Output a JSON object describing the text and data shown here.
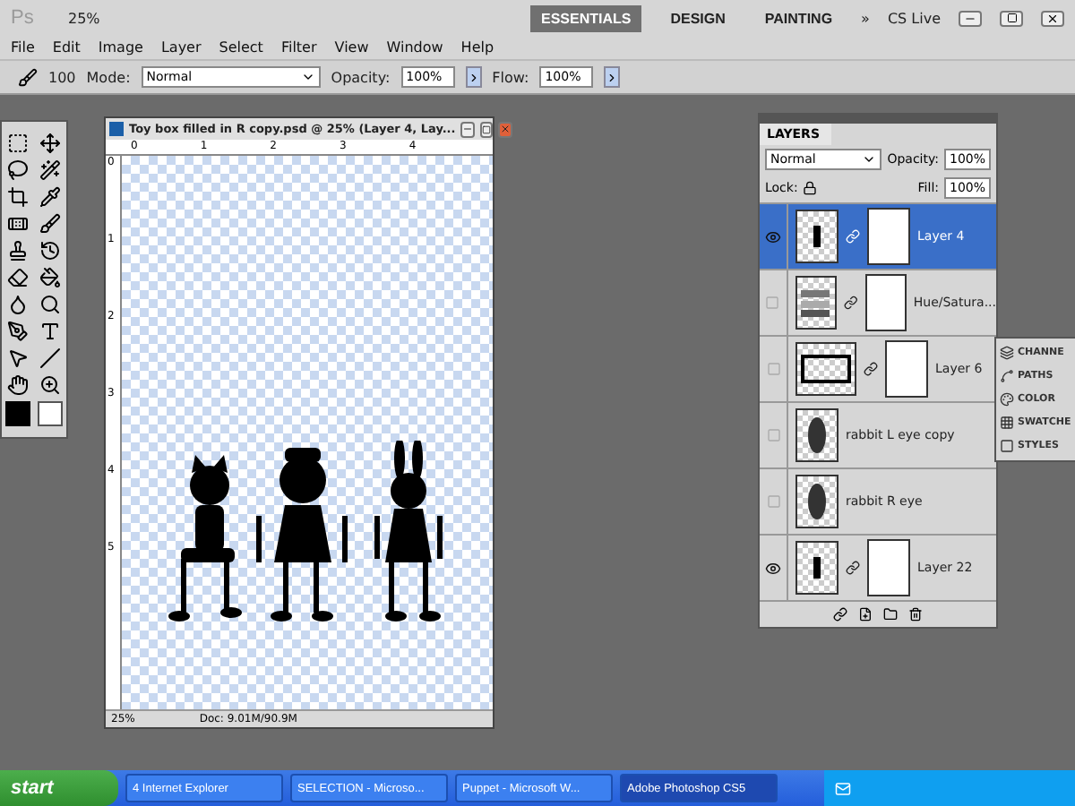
{
  "app_bar": {
    "logo": "Ps",
    "zoom": "25%",
    "workspaces": [
      {
        "label": "ESSENTIALS",
        "selected": true
      },
      {
        "label": "DESIGN",
        "selected": false
      },
      {
        "label": "PAINTING",
        "selected": false
      }
    ],
    "more": "»",
    "cs_live": "CS Live"
  },
  "menu": [
    "File",
    "Edit",
    "Image",
    "Layer",
    "Select",
    "Filter",
    "View",
    "Window",
    "Help"
  ],
  "options": {
    "brush_size": "100",
    "mode_label": "Mode:",
    "mode": "Normal",
    "opacity_label": "Opacity:",
    "opacity": "100%",
    "flow_label": "Flow:",
    "flow": "100%"
  },
  "document": {
    "title": "Toy box filled in R copy.psd @ 25% (Layer 4, Lay...",
    "ruler_h": [
      "0",
      "1",
      "2",
      "3",
      "4"
    ],
    "ruler_v": [
      "0",
      "1",
      "2",
      "3",
      "4",
      "5"
    ],
    "zoom": "25%",
    "doc_size": "Doc: 9.01M/90.9M"
  },
  "layers": {
    "tab": "LAYERS",
    "blend": "Normal",
    "opacity_label": "Opacity:",
    "opacity": "100%",
    "lock_label": "Lock:",
    "fill_label": "Fill:",
    "fill": "100%",
    "items": [
      {
        "name": "Layer 4",
        "visible": true,
        "selected": true,
        "kind": "masked"
      },
      {
        "name": "Hue/Satura...",
        "visible": false,
        "selected": false,
        "kind": "adjustment"
      },
      {
        "name": "Layer 6",
        "visible": false,
        "selected": false,
        "kind": "frame"
      },
      {
        "name": "rabbit L eye   copy",
        "visible": false,
        "selected": false,
        "kind": "pixel"
      },
      {
        "name": "rabbit R eye",
        "visible": false,
        "selected": false,
        "kind": "pixel"
      },
      {
        "name": "Layer 22",
        "visible": true,
        "selected": false,
        "kind": "masked"
      }
    ]
  },
  "side_panels": [
    {
      "label": "CHANNE",
      "kind": "channels"
    },
    {
      "label": "PATHS",
      "kind": "paths"
    },
    {
      "label": "COLOR",
      "kind": "color"
    },
    {
      "label": "SWATCHE",
      "kind": "swatches"
    },
    {
      "label": "STYLES",
      "kind": "styles"
    }
  ],
  "taskbar": {
    "start": "start",
    "tasks": [
      {
        "label": "4 Internet Explorer",
        "selected": false
      },
      {
        "label": "SELECTION - Microso...",
        "selected": false
      },
      {
        "label": "Puppet - Microsoft W...",
        "selected": false
      },
      {
        "label": "Adobe Photoshop CS5",
        "selected": true
      }
    ]
  }
}
